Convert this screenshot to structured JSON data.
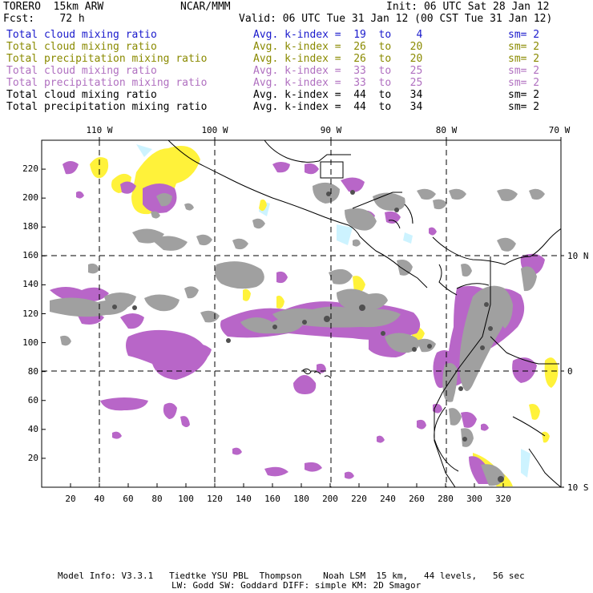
{
  "header": {
    "model": "TORERO  15km ARW",
    "center": "NCAR/MMM",
    "init": "Init: 06 UTC Sat 28 Jan 12",
    "fcst": "Fcst:    72 h",
    "valid": "Valid: 06 UTC Tue 31 Jan 12 (00 CST Tue 31 Jan 12)"
  },
  "legend": [
    {
      "field": "Total cloud mixing ratio",
      "index": "Avg. k-index =  19  to    4",
      "sm": "sm= 2",
      "color": "#1a1acc"
    },
    {
      "field": "Total cloud mixing ratio",
      "index": "Avg. k-index =  26  to   20",
      "sm": "sm= 2",
      "color": "#8a8a00"
    },
    {
      "field": "Total precipitation mixing ratio",
      "index": "Avg. k-index =  26  to   20",
      "sm": "sm= 2",
      "color": "#8a8a00"
    },
    {
      "field": "Total cloud mixing ratio",
      "index": "Avg. k-index =  33  to   25",
      "sm": "sm= 2",
      "color": "#b070c0"
    },
    {
      "field": "Total precipitation mixing ratio",
      "index": "Avg. k-index =  33  to   25",
      "sm": "sm= 2",
      "color": "#b070c0"
    },
    {
      "field": "Total cloud mixing ratio",
      "index": "Avg. k-index =  44  to   34",
      "sm": "sm= 2",
      "color": "#000000"
    },
    {
      "field": "Total precipitation mixing ratio",
      "index": "Avg. k-index =  44  to   34",
      "sm": "sm= 2",
      "color": "#000000"
    }
  ],
  "map": {
    "lon_labels": [
      "110 W",
      "100 W",
      "90 W",
      "80 W",
      "70 W"
    ],
    "lat_labels": [
      "10 N",
      "0",
      "10 S"
    ],
    "y_ticks": [
      "220",
      "200",
      "180",
      "160",
      "140",
      "120",
      "100",
      "80",
      "60",
      "40",
      "20"
    ],
    "x_ticks": [
      "20",
      "40",
      "60",
      "80",
      "100",
      "120",
      "140",
      "160",
      "180",
      "200",
      "220",
      "240",
      "260",
      "280",
      "300",
      "320"
    ],
    "colors": {
      "gray": "#a0a0a0",
      "gray_dark": "#505050",
      "yellow": "#fff23a",
      "purple": "#b866c8",
      "cyan": "#cdf3ff"
    }
  },
  "footer": {
    "line1": "Model Info: V3.3.1   Tiedtke YSU PBL  Thompson    Noah LSM  15 km,   44 levels,   56 sec",
    "line2": "LW: Godd SW: Goddard DIFF: simple KM: 2D Smagor"
  }
}
